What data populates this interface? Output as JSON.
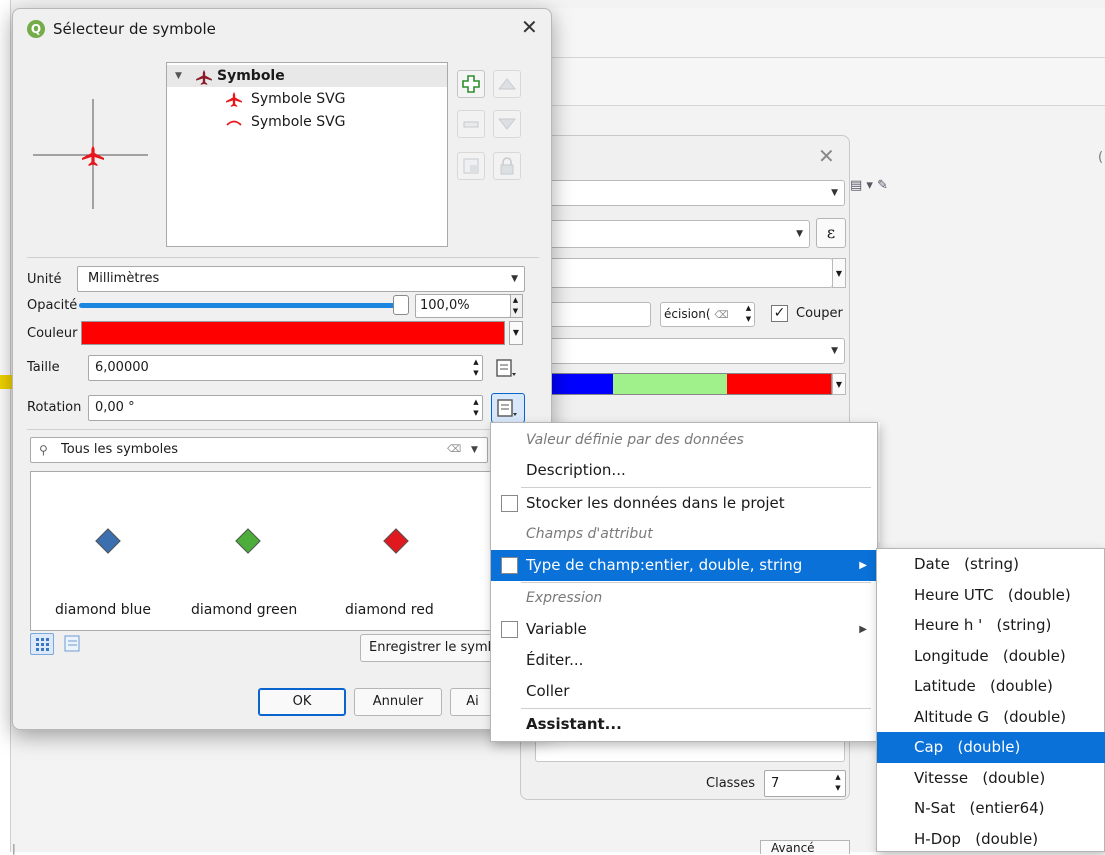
{
  "dialog": {
    "title": "Sélecteur de symbole",
    "tree": {
      "root": "Symbole",
      "layers": [
        "Symbole SVG",
        "Symbole SVG"
      ]
    },
    "unit": {
      "label": "Unité",
      "value": "Millimètres"
    },
    "opacity": {
      "label": "Opacité",
      "value": "100,0%",
      "fraction": 1.0
    },
    "color": {
      "label": "Couleur",
      "hex": "#ff0000"
    },
    "size": {
      "label": "Taille",
      "value": "6,00000"
    },
    "rotation": {
      "label": "Rotation",
      "value": "0,00 °"
    },
    "search": {
      "value": "Tous les symboles"
    },
    "symbols": [
      {
        "name": "diamond blue",
        "color": "#3b6fb0"
      },
      {
        "name": "diamond green",
        "color": "#4cad3a"
      },
      {
        "name": "diamond red",
        "color": "#e0191e"
      }
    ],
    "save_label": "Enregistrer le symb",
    "ok_label": "OK",
    "cancel_label": "Annuler",
    "help_label": "Ai"
  },
  "middle": {
    "decimal_value": "écision(",
    "cut_label": "Couper",
    "classes_label": "Classes",
    "classes_value": "7",
    "bottom_partial": "Avancé"
  },
  "menu": {
    "header_data": "Valeur définie par des données",
    "description": "Description...",
    "store": "Stocker les données dans le projet",
    "header_fields": "Champs d'attribut",
    "field_type": "Type de champ:entier, double, string",
    "header_expression": "Expression",
    "variable": "Variable",
    "edit": "Éditer...",
    "paste": "Coller",
    "assistant": "Assistant..."
  },
  "submenu": [
    "Date   (string)",
    "Heure UTC   (double)",
    "Heure h '   (string)",
    "Longitude   (double)",
    "Latitude   (double)",
    "Altitude G   (double)",
    "Cap   (double)",
    "Vitesse   (double)",
    "N-Sat   (entier64)",
    "H-Dop   (double)"
  ],
  "submenu_selected": "Cap   (double)",
  "colors": {
    "accent": "#0a71d8",
    "ramp": [
      "#0000ff",
      "#a0f08c",
      "#ff0000"
    ]
  }
}
